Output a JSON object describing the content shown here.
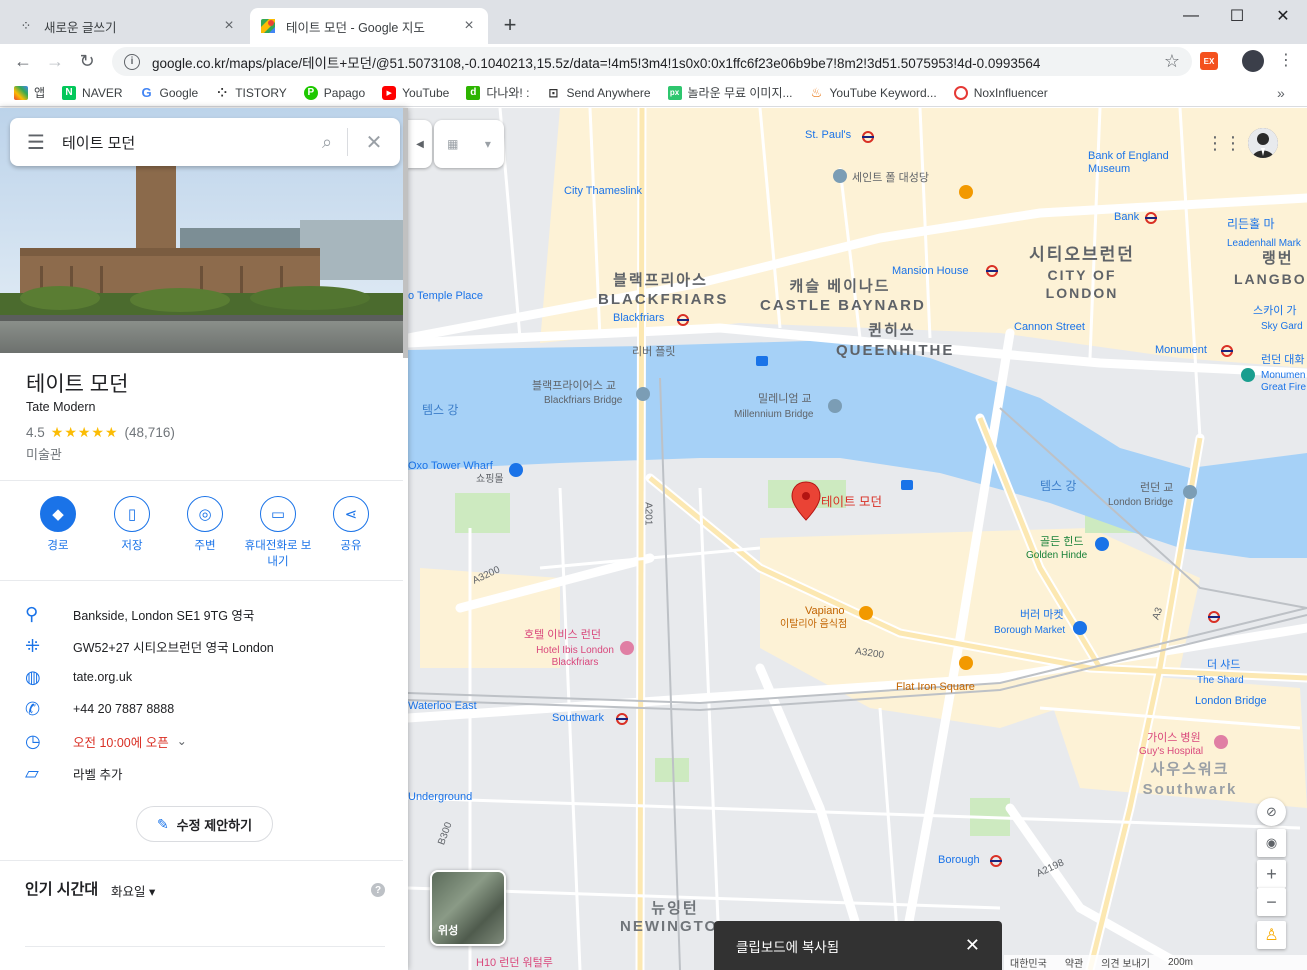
{
  "browser": {
    "tabs": [
      {
        "title": "새로운 글쓰기",
        "active": false
      },
      {
        "title": "테이트 모던 - Google 지도",
        "active": true
      }
    ],
    "url": "google.co.kr/maps/place/테이트+모던/@51.5073108,-0.1040213,15.5z/data=!4m5!3m4!1s0x0:0x1ffc6f23e06b9be7!8m2!3d51.5075953!4d-0.0993564",
    "bookmarks": [
      "앱",
      "NAVER",
      "Google",
      "TISTORY",
      "Papago",
      "YouTube",
      "다나와! :",
      "Send Anywhere",
      "놀라운 무료 이미지...",
      "YouTube Keyword...",
      "NoxInfluencer"
    ],
    "more_chevron": "»"
  },
  "search": {
    "query": "테이트 모던"
  },
  "place": {
    "name": "테이트 모던",
    "name_en": "Tate Modern",
    "rating": "4.5",
    "stars": "★★★★★",
    "reviews": "(48,716)",
    "category": "미술관",
    "actions": [
      {
        "label": "경로",
        "icon": "directions-icon"
      },
      {
        "label": "저장",
        "icon": "bookmark-icon"
      },
      {
        "label": "주변",
        "icon": "nearby-icon"
      },
      {
        "label": "휴대전화로 보내기",
        "icon": "send-to-phone-icon"
      },
      {
        "label": "공유",
        "icon": "share-icon"
      }
    ],
    "address": "Bankside, London SE1 9TG 영국",
    "plus_code": "GW52+27 시티오브런던 영국 London",
    "website": "tate.org.uk",
    "phone": "+44 20 7887 8888",
    "hours": "오전 10:00에 오픈",
    "label": "라벨 추가",
    "suggest_edit": "수정 제안하기",
    "popular_times": "인기 시간대",
    "popular_day": "화요일"
  },
  "map": {
    "satellite_label": "위성",
    "toast": "클립보드에 복사됨",
    "footer": [
      "대한민국",
      "약관",
      "의견 보내기",
      "200m"
    ],
    "labels": {
      "stpauls": "St. Paul's",
      "stpauls_cathedral": "세인트 폴 대성당",
      "bank_of_england": "Bank of England Museum",
      "bank": "Bank",
      "city_thameslink": "City Thameslink",
      "blackfriars_ko": "블랙프리아스",
      "blackfriars_en": "BLACKFRIARS",
      "blackfriars_station": "Blackfriars",
      "castle_ko": "캐슬 베이나드",
      "castle_en": "CASTLE BAYNARD",
      "queenhithe_ko": "퀸히쓰",
      "queenhithe_en": "QUEENHITHE",
      "mansion_house": "Mansion House",
      "city_ko": "시티오브런던",
      "city_en": "CITY OF LONDON",
      "cannon_street": "Cannon Street",
      "monument": "Monument",
      "temple_place": "o Temple Place",
      "river_plate": "리버 플릿",
      "blackfriars_bridge_ko": "블랙프라이어스 교",
      "blackfriars_bridge_en": "Blackfriars Bridge",
      "millennium_ko": "밀레니엄 교",
      "millennium_en": "Millennium Bridge",
      "thames_w": "템스 강",
      "thames_e": "템스 강",
      "oxo_tower": "Oxo Tower Wharf",
      "oxo_shop": "쇼핑몰",
      "tate_pin": "테이트 모던",
      "london_bridge_ko": "런던 교",
      "london_bridge_en": "London Bridge",
      "golden_hinde_ko": "골든 힌드",
      "golden_hinde_en": "Golden Hinde",
      "vapiano": "Vapiano",
      "vapiano_sub": "이탈리아 음식점",
      "ibis_ko": "호텔 이비스 런던",
      "ibis_en": "Hotel Ibis London Blackfriars",
      "borough_market_ko": "버러 마켓",
      "borough_market_en": "Borough Market",
      "flat_iron": "Flat Iron Square",
      "shard_ko": "더 샤드",
      "shard_en": "The Shard",
      "london_bridge_station": "London Bridge",
      "waterloo_east": "Waterloo East",
      "southwark_station": "Southwark",
      "guys_ko": "가이스 병원",
      "guys_en": "Guy's Hospital",
      "southwark_ko": "사우스워크",
      "southwark_en": "Southwark",
      "underground": "Underground",
      "borough": "Borough",
      "newington_ko": "뉴잉턴",
      "newington_en": "NEWINGTON",
      "a201": "A201",
      "a3200": "A3200",
      "a3": "A3",
      "a2198": "A2198",
      "b300": "B300",
      "a3200b": "A3200",
      "leadenhall_ko": "리든홀 마",
      "leadenhall_en": "Leadenhall Mark",
      "langbourn_ko": "랭번",
      "langbourn_en": "LANGBO",
      "sky_garden_ko": "스카이 가",
      "sky_garden_en": "Sky Gard",
      "monument_fire_ko": "런던 대화",
      "monument_fire_en": "Monumen Great Fire",
      "h10": "H10 런던 워털루"
    }
  }
}
